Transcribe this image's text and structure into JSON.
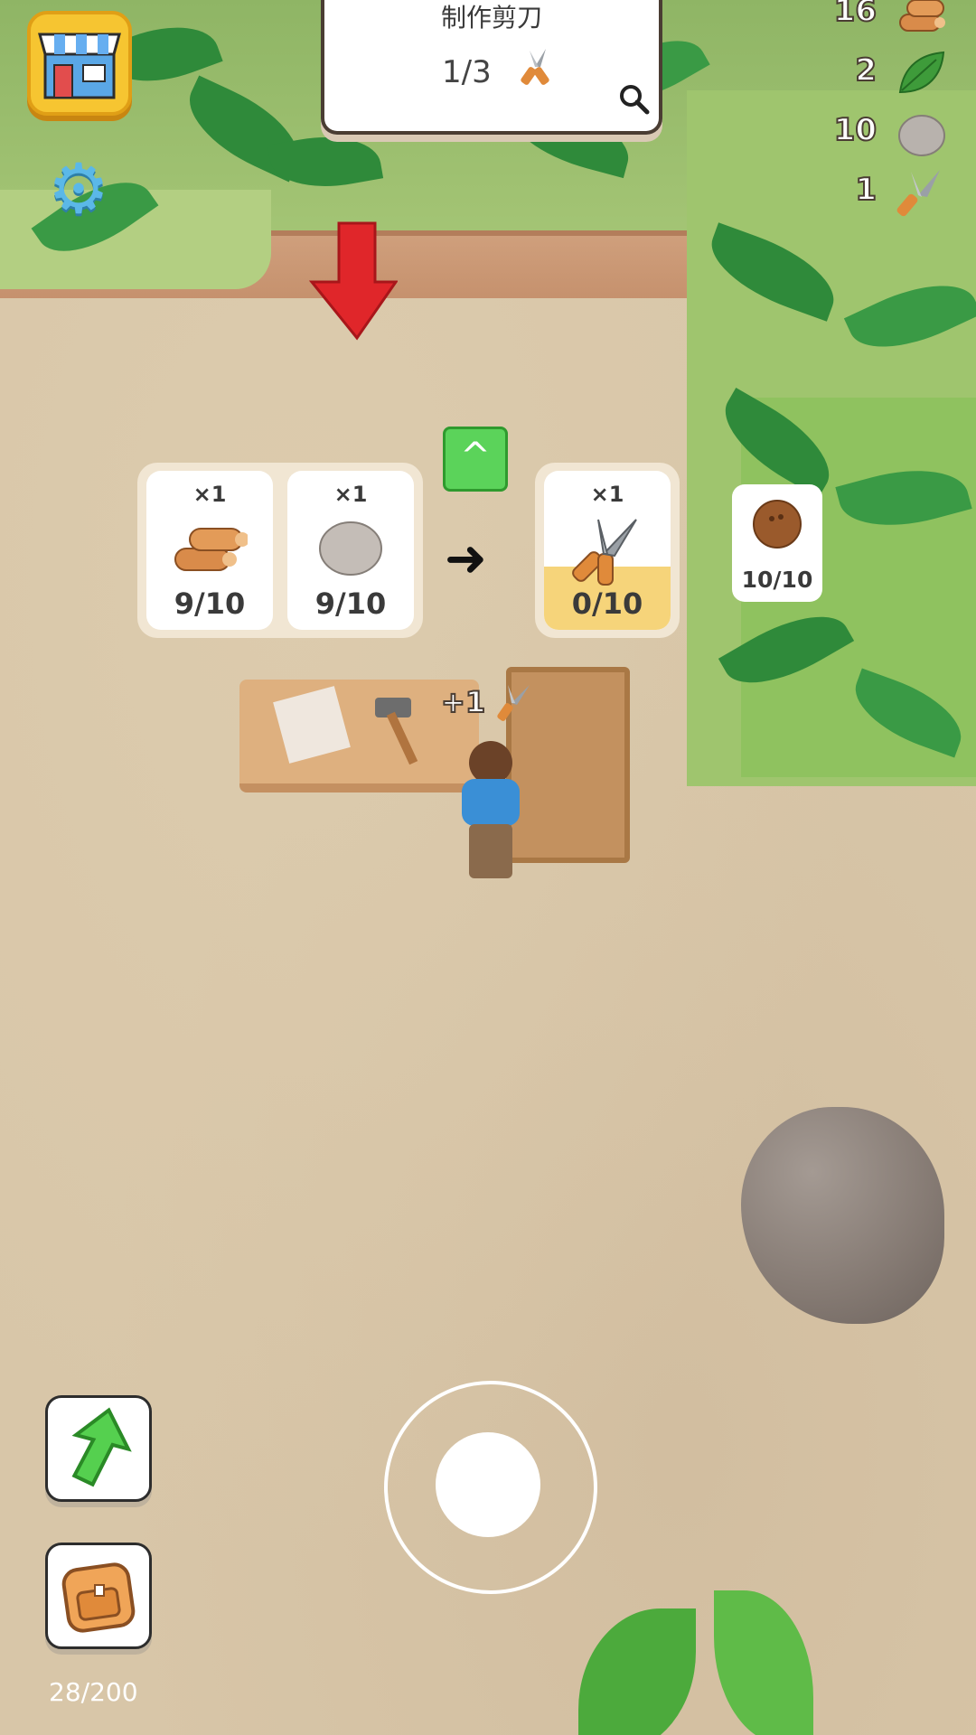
{
  "hud": {
    "shop_icon": "shop-icon",
    "settings_icon": "gear-icon",
    "quest": {
      "title": "制作剪刀",
      "progress": "1/3",
      "icon": "shears-icon",
      "search_icon": "magnifier-icon"
    },
    "resources": [
      {
        "name": "wood",
        "count": "16",
        "icon": "wood-logs-icon"
      },
      {
        "name": "leaf",
        "count": "2",
        "icon": "leaf-icon"
      },
      {
        "name": "stone",
        "count": "10",
        "icon": "stone-icon"
      },
      {
        "name": "shears",
        "count": "1",
        "icon": "shears-icon"
      }
    ]
  },
  "recipe": {
    "inputs": [
      {
        "multiplier": "×1",
        "count": "9/10",
        "icon": "wood-logs-icon"
      },
      {
        "multiplier": "×1",
        "count": "9/10",
        "icon": "stone-icon"
      }
    ],
    "output": {
      "multiplier": "×1",
      "count": "0/10",
      "icon": "shears-icon",
      "fill_fraction": 0.4
    },
    "arrow_icon": "right-arrow-icon",
    "upgrade_icon": "chevron-up-icon"
  },
  "coconut_card": {
    "count": "10/10",
    "icon": "coconut-icon"
  },
  "floating_reward": {
    "text": "+1",
    "icon": "shears-icon"
  },
  "controls": {
    "upgrade_icon": "green-up-arrow-icon",
    "backpack_icon": "backpack-icon",
    "storage": "28/200"
  },
  "colors": {
    "sand": "#d8c6a8",
    "grass": "#9fc56e",
    "accent_green": "#5bd35a",
    "output_fill": "#f6d47a",
    "shop_yellow": "#f6c531",
    "marker_red": "#e0262a"
  }
}
